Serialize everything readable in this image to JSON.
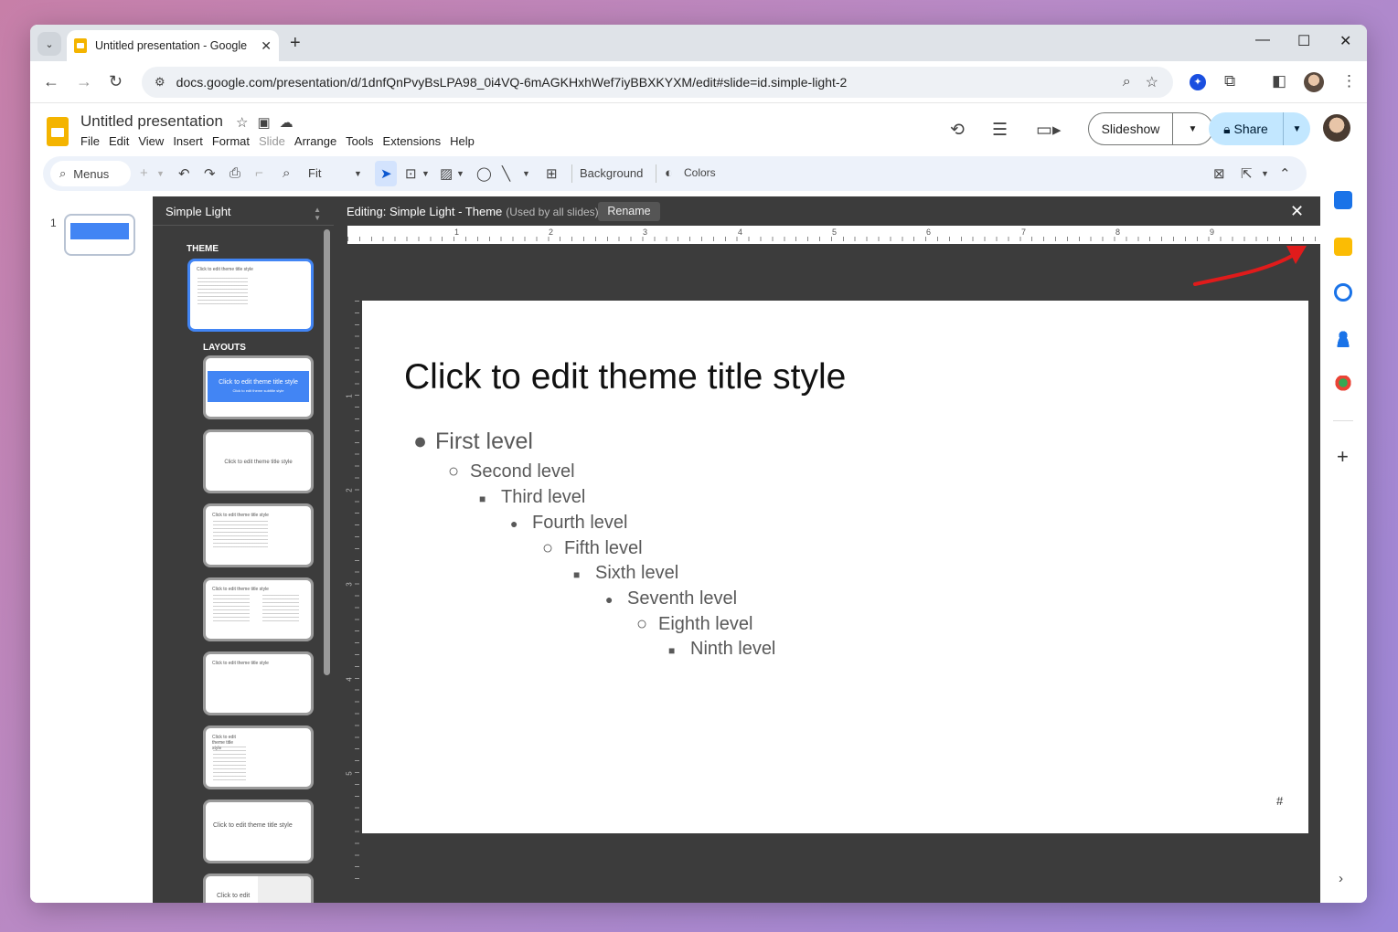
{
  "browser": {
    "tab_title": "Untitled presentation - Google",
    "tab_close": "✕",
    "new_tab": "+",
    "url": "docs.google.com/presentation/d/1dnfQnPvyBsLPA98_0i4VQ-6mAGKHxhWef7iyBBXKYXM/edit#slide=id.simple-light-2",
    "minimize": "—",
    "maximize": "☐",
    "close": "✕"
  },
  "app": {
    "doc_title": "Untitled presentation",
    "menu": [
      "File",
      "Edit",
      "View",
      "Insert",
      "Format",
      "Slide",
      "Arrange",
      "Tools",
      "Extensions",
      "Help"
    ],
    "slideshow_label": "Slideshow",
    "share_label": "Share"
  },
  "toolbar": {
    "menus_label": "Menus",
    "zoom_label": "Fit",
    "background_label": "Background",
    "colors_label": "Colors"
  },
  "filmstrip": {
    "slide_number": "1"
  },
  "theme_panel": {
    "title": "Simple Light",
    "theme_label": "THEME",
    "layouts_label": "LAYOUTS",
    "layouts": [
      "Click to edit theme title style",
      "Click to edit theme title style",
      "Click to edit theme title style",
      "Click to edit theme title style",
      "Click to edit theme title style",
      "Click to edit theme title style",
      "Click to edit theme title style",
      "Click to edit"
    ],
    "layout0_sub": "Click to edit theme subtitle style"
  },
  "editor": {
    "editing_label": "Editing: Simple Light - Theme",
    "used_label": "(Used by all slides)",
    "rename_label": "Rename",
    "close_label": "✕",
    "ruler_h": [
      "1",
      "2",
      "3",
      "4",
      "5",
      "6",
      "7",
      "8",
      "9"
    ],
    "ruler_v": [
      "1",
      "2",
      "3",
      "4",
      "5"
    ]
  },
  "slide": {
    "title": "Click to edit theme title style",
    "levels": [
      {
        "bullet": "●",
        "text": "First level"
      },
      {
        "bullet": "○",
        "text": "Second level"
      },
      {
        "bullet": "■",
        "text": "Third level"
      },
      {
        "bullet": "●",
        "text": "Fourth level"
      },
      {
        "bullet": "○",
        "text": "Fifth level"
      },
      {
        "bullet": "■",
        "text": "Sixth level"
      },
      {
        "bullet": "●",
        "text": "Seventh level"
      },
      {
        "bullet": "○",
        "text": "Eighth level"
      },
      {
        "bullet": "■",
        "text": "Ninth level"
      }
    ],
    "slide_number_placeholder": "#"
  },
  "colors": {
    "accent_blue": "#4285f4",
    "share_bg": "#c2e7ff",
    "dark_panel": "#3c3c3c",
    "annotation_red": "#e01b1b"
  }
}
